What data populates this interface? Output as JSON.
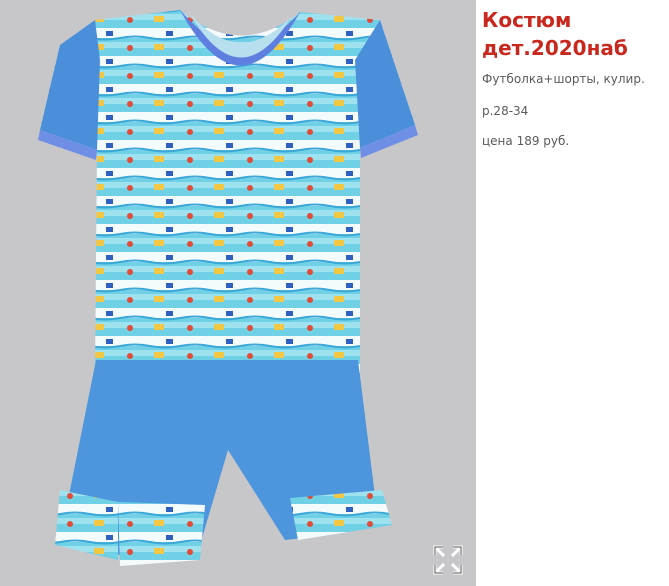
{
  "product": {
    "title_line1": "Костюм",
    "title_line2": "дет.2020наб",
    "description": "Футболка+шорты, кулир.",
    "sizes": "р.28-34",
    "price": "цена 189 руб."
  },
  "photo": {
    "expand_icon": "expand-arrows-icon"
  },
  "colors": {
    "title": "#c8281e",
    "text": "#5a5a5a",
    "background_photo": "#c7c7c9",
    "sleeve_blue": "#4b8fdb",
    "shorts_blue": "#4d95dc",
    "stripe_cyan": "#6fd0e6",
    "stripe_white": "#f4fbfd"
  }
}
